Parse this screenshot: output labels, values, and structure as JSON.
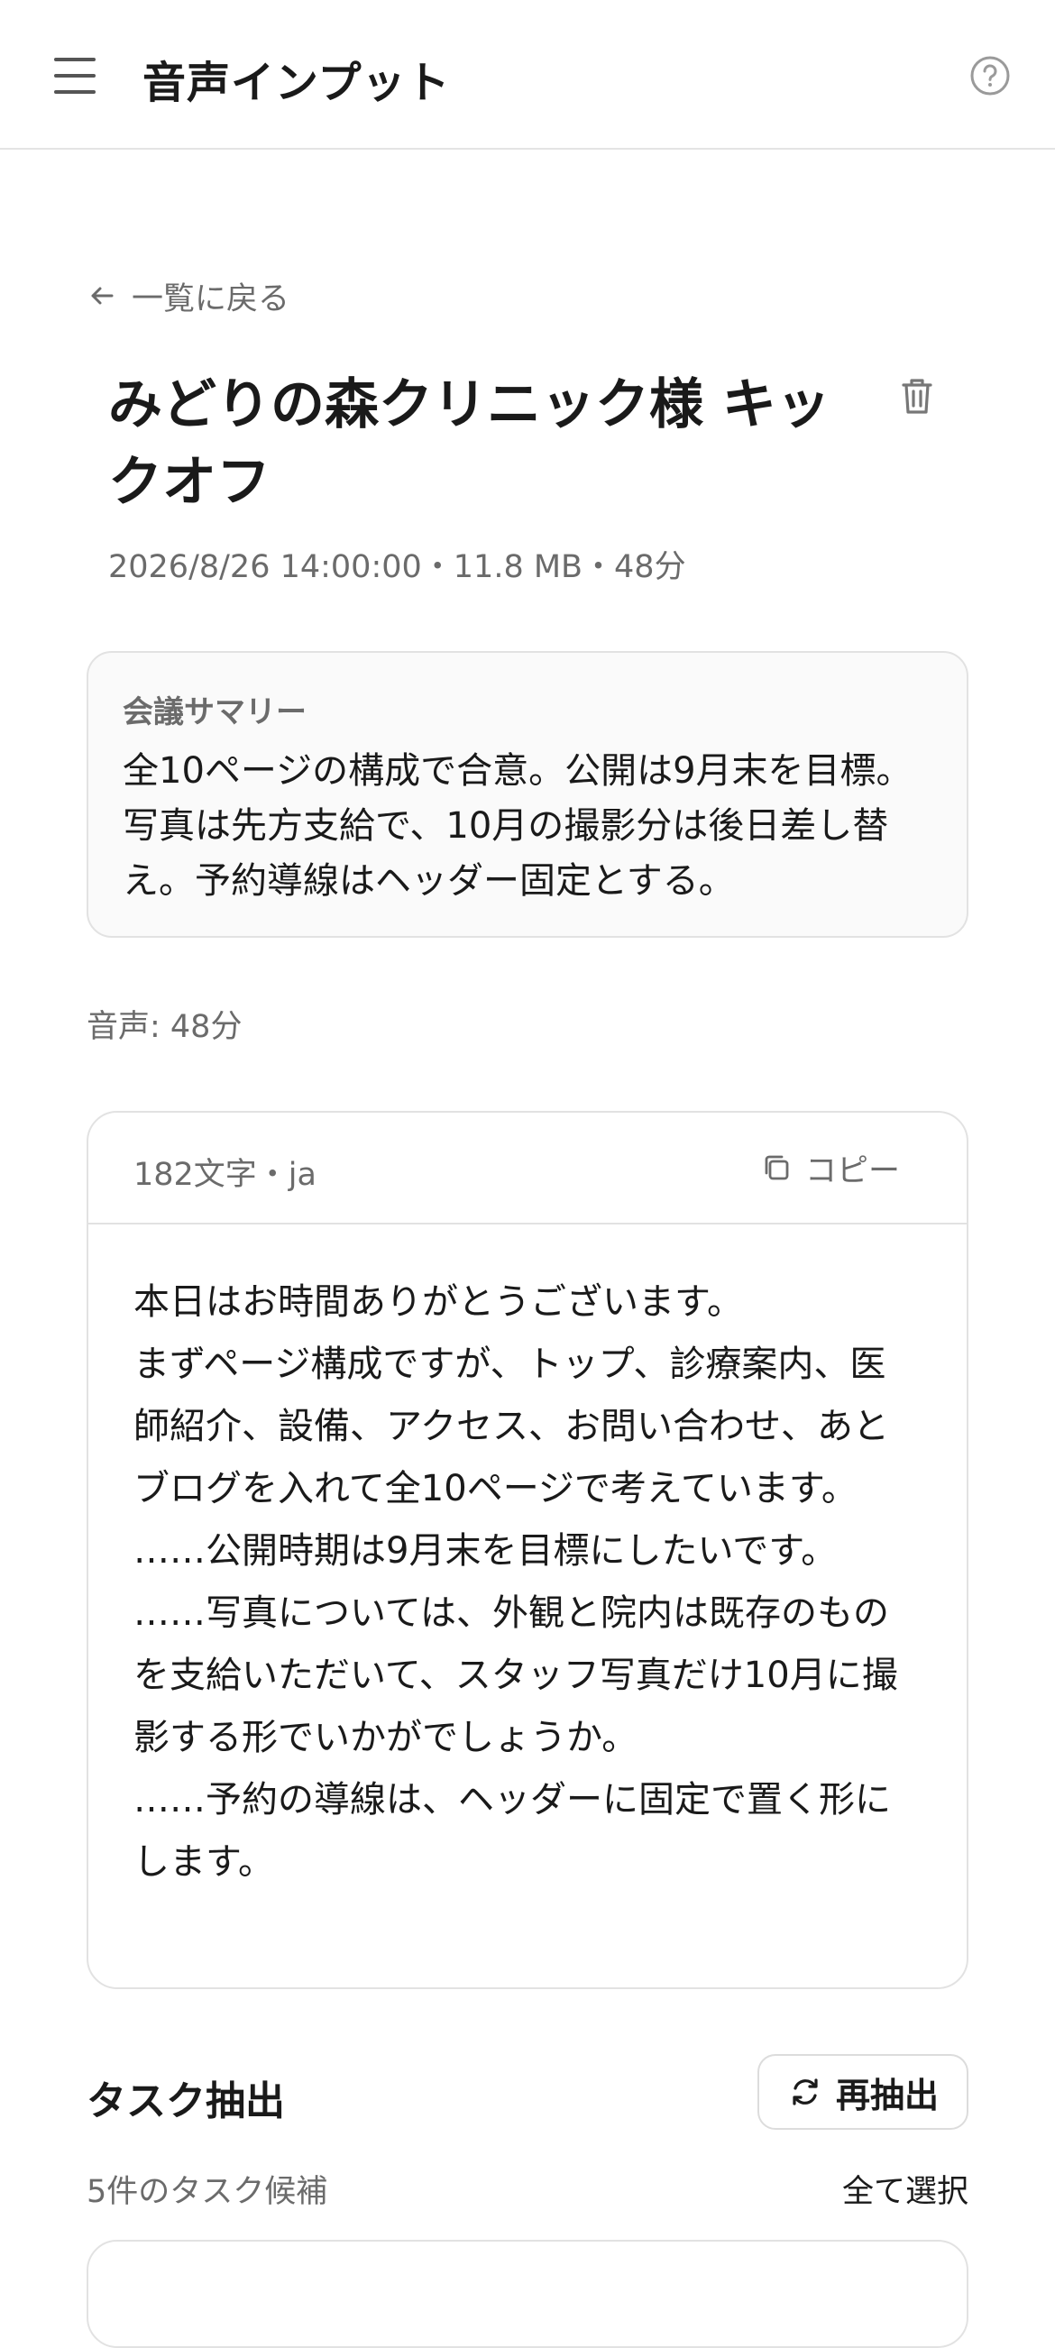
{
  "header": {
    "title": "音声インプット",
    "menu_icon": "hamburger-menu-icon",
    "help_icon": "question-circle-icon"
  },
  "back_link": {
    "label": "一覧に戻る",
    "icon": "arrow-left-icon"
  },
  "meeting": {
    "title": "みどりの森クリニック様 キックオフ",
    "meta": "2026/8/26 14:00:00・11.8 MB・48分",
    "delete_icon": "trash-icon"
  },
  "summary": {
    "label": "会議サマリー",
    "text": "全10ページの構成で合意。公開は9月末を目標。写真は先方支給で、10月の撮影分は後日差し替え。予約導線はヘッダー固定とする。"
  },
  "audio": {
    "label": "音声: 48分"
  },
  "transcript": {
    "char_count": "182文字・ja",
    "copy_label": "コピー",
    "lines": [
      "本日はお時間ありがとうございます。",
      "まずページ構成ですが、トップ、診療案内、医師紹介、設備、アクセス、お問い合わせ、あとブログを入れて全10ページで考えています。",
      "……公開時期は9月末を目標にしたいです。",
      "……写真については、外観と院内は既存のものを支給いただいて、スタッフ写真だけ10月に撮影する形でいかがでしょうか。",
      "……予約の導線は、ヘッダーに固定で置く形にします。"
    ]
  },
  "tasks": {
    "title": "タスク抽出",
    "reextract_label": "再抽出",
    "count": "5件のタスク候補",
    "select_all": "全て選択"
  },
  "colors": {
    "text": "#1a1a1a",
    "muted": "#6b6b6b",
    "border": "#e2e2e2",
    "card_bg": "#fafafa"
  }
}
